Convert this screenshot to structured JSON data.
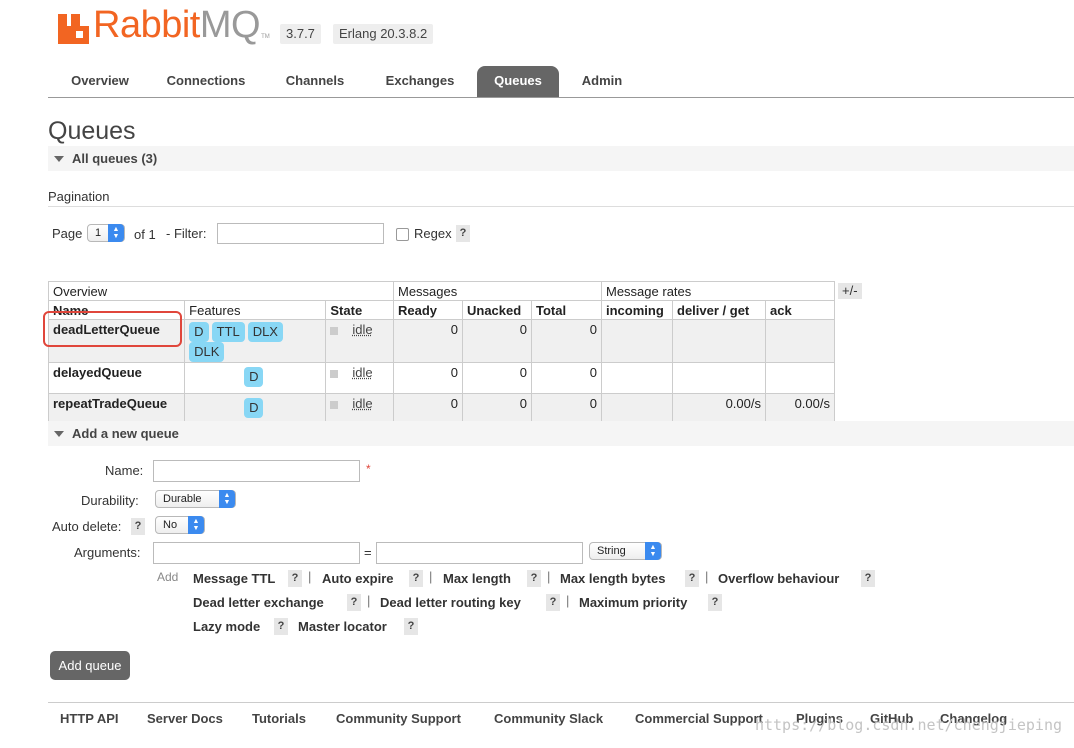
{
  "header": {
    "logo_rabbit": "Rabbit",
    "logo_mq": "MQ",
    "logo_tm": "TM",
    "version": "3.7.7",
    "erlang": "Erlang 20.3.8.2"
  },
  "nav": {
    "tabs": [
      "Overview",
      "Connections",
      "Channels",
      "Exchanges",
      "Queues",
      "Admin"
    ],
    "active": "Queues"
  },
  "page_title": "Queues",
  "all_queues": {
    "label": "All queues (3)"
  },
  "pagination": {
    "heading": "Pagination",
    "page_label": "Page",
    "page_value": "1",
    "of_label": "of 1",
    "filter_label": "- Filter:",
    "filter_value": "",
    "regex_label": "Regex",
    "help": "?"
  },
  "table": {
    "group_headers": [
      "Overview",
      "Messages",
      "Message rates"
    ],
    "plus_minus": "+/-",
    "columns": [
      "Name",
      "Features",
      "State",
      "Ready",
      "Unacked",
      "Total",
      "incoming",
      "deliver / get",
      "ack"
    ],
    "rows": [
      {
        "name": "deadLetterQueue",
        "features": [
          "D",
          "TTL",
          "DLX",
          "DLK"
        ],
        "state": "idle",
        "ready": "0",
        "unacked": "0",
        "total": "0",
        "incoming": "",
        "deliver_get": "",
        "ack": ""
      },
      {
        "name": "delayedQueue",
        "features": [
          "D"
        ],
        "state": "idle",
        "ready": "0",
        "unacked": "0",
        "total": "0",
        "incoming": "",
        "deliver_get": "",
        "ack": ""
      },
      {
        "name": "repeatTradeQueue",
        "features": [
          "D"
        ],
        "state": "idle",
        "ready": "0",
        "unacked": "0",
        "total": "0",
        "incoming": "",
        "deliver_get": "0.00/s",
        "ack": "0.00/s"
      }
    ]
  },
  "add_queue": {
    "section_label": "Add a new queue",
    "name_label": "Name:",
    "name_value": "",
    "required_mark": "*",
    "durability_label": "Durability:",
    "durability_value": "Durable",
    "auto_delete_label": "Auto delete:",
    "auto_delete_value": "No",
    "arguments_label": "Arguments:",
    "equals": "=",
    "arg_type_value": "String",
    "add_label": "Add",
    "arg_links": [
      "Message TTL",
      "Auto expire",
      "Max length",
      "Max length bytes",
      "Overflow behaviour",
      "Dead letter exchange",
      "Dead letter routing key",
      "Maximum priority",
      "Lazy mode",
      "Master locator"
    ],
    "separator": "|",
    "button_label": "Add queue"
  },
  "footer": {
    "links": [
      "HTTP API",
      "Server Docs",
      "Tutorials",
      "Community Support",
      "Community Slack",
      "Commercial Support",
      "Plugins",
      "GitHub",
      "Changelog"
    ]
  },
  "watermark": "https://blog.csdn.net/chengjieping"
}
